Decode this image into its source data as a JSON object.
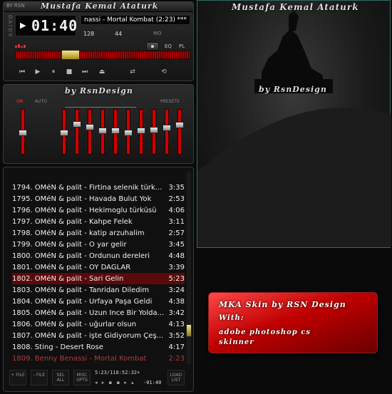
{
  "player": {
    "title": "Mustafa Kemal Ataturk",
    "mini_brand": "BY RSN",
    "time": "01:40",
    "track_title": "nassi - Mortal Kombat (2:23)",
    "marquee_tail": "***",
    "kbps": "128",
    "khz": "44",
    "flags": {
      "mono": "MO",
      "eq": "EQ",
      "pl": "PL"
    },
    "side_letters": "OAIDV"
  },
  "eq": {
    "title": "by RsnDesign",
    "on_label": "ON",
    "auto_label": "AUTO",
    "presets_label": "PRESETS",
    "bands": [
      0.5,
      0.5,
      0.28,
      0.35,
      0.45,
      0.45,
      0.5,
      0.45,
      0.42,
      0.38,
      0.3,
      0.3,
      0.4
    ]
  },
  "playlist": {
    "items": [
      {
        "text": "1794. OMéN & palit - Firtina selenik türk...",
        "dur": "3:35"
      },
      {
        "text": "1795. OMéN & palit - Havada Bulut Yok",
        "dur": "2:53"
      },
      {
        "text": "1796. OMéN & palit - Hekimoglu türküsü",
        "dur": "4:06"
      },
      {
        "text": "1797. OMéN & palit - Kahpe Felek",
        "dur": "3:11"
      },
      {
        "text": "1798. OMéN & palit - katip arzuhalim",
        "dur": "2:57"
      },
      {
        "text": "1799. OMéN & palit - O yar gelir",
        "dur": "3:45"
      },
      {
        "text": "1800. OMéN & palit - Ordunun dereleri",
        "dur": "4:48"
      },
      {
        "text": "1801. OMéN & palit - OY DAGLAR",
        "dur": "3:39"
      },
      {
        "text": "1802. OMéN & palit - Sari Gelin",
        "dur": "5:23"
      },
      {
        "text": "1803. OMéN & palit - Tanridan Diledim",
        "dur": "3:24"
      },
      {
        "text": "1804. OMéN & palit - Urfaya Paşa Geldi",
        "dur": "4:38"
      },
      {
        "text": "1805. OMéN & palit - Uzun Ince Bir Yolda...",
        "dur": "3:42"
      },
      {
        "text": "1806. OMéN & palit - uğurlar olsun",
        "dur": "4:13"
      },
      {
        "text": "1807. OMéN & palit - işte Gidiyorum Çeş...",
        "dur": "3:52"
      },
      {
        "text": "1808. Sting - Desert Rose",
        "dur": "4:17"
      },
      {
        "text": "1809. Benny Benassi - Mortal Kombat",
        "dur": "2:23"
      }
    ],
    "selected_index": 8,
    "current_index": 15,
    "footer": {
      "add": "+ FILE",
      "rem": "- FILE",
      "sel": "SEL ALL",
      "misc": "MISC OPTS",
      "info": "5:23/118:52:32+",
      "time": "-01:40",
      "list": "LOAD LIST"
    }
  },
  "side": {
    "title": "Mustafa Kemal Ataturk",
    "subtitle": "by RsnDesign"
  },
  "info_box": {
    "line1": "MKA Skin by RSN Design",
    "line2": "With:",
    "line3": "adobe photoshop cs",
    "line4": "skinner"
  }
}
